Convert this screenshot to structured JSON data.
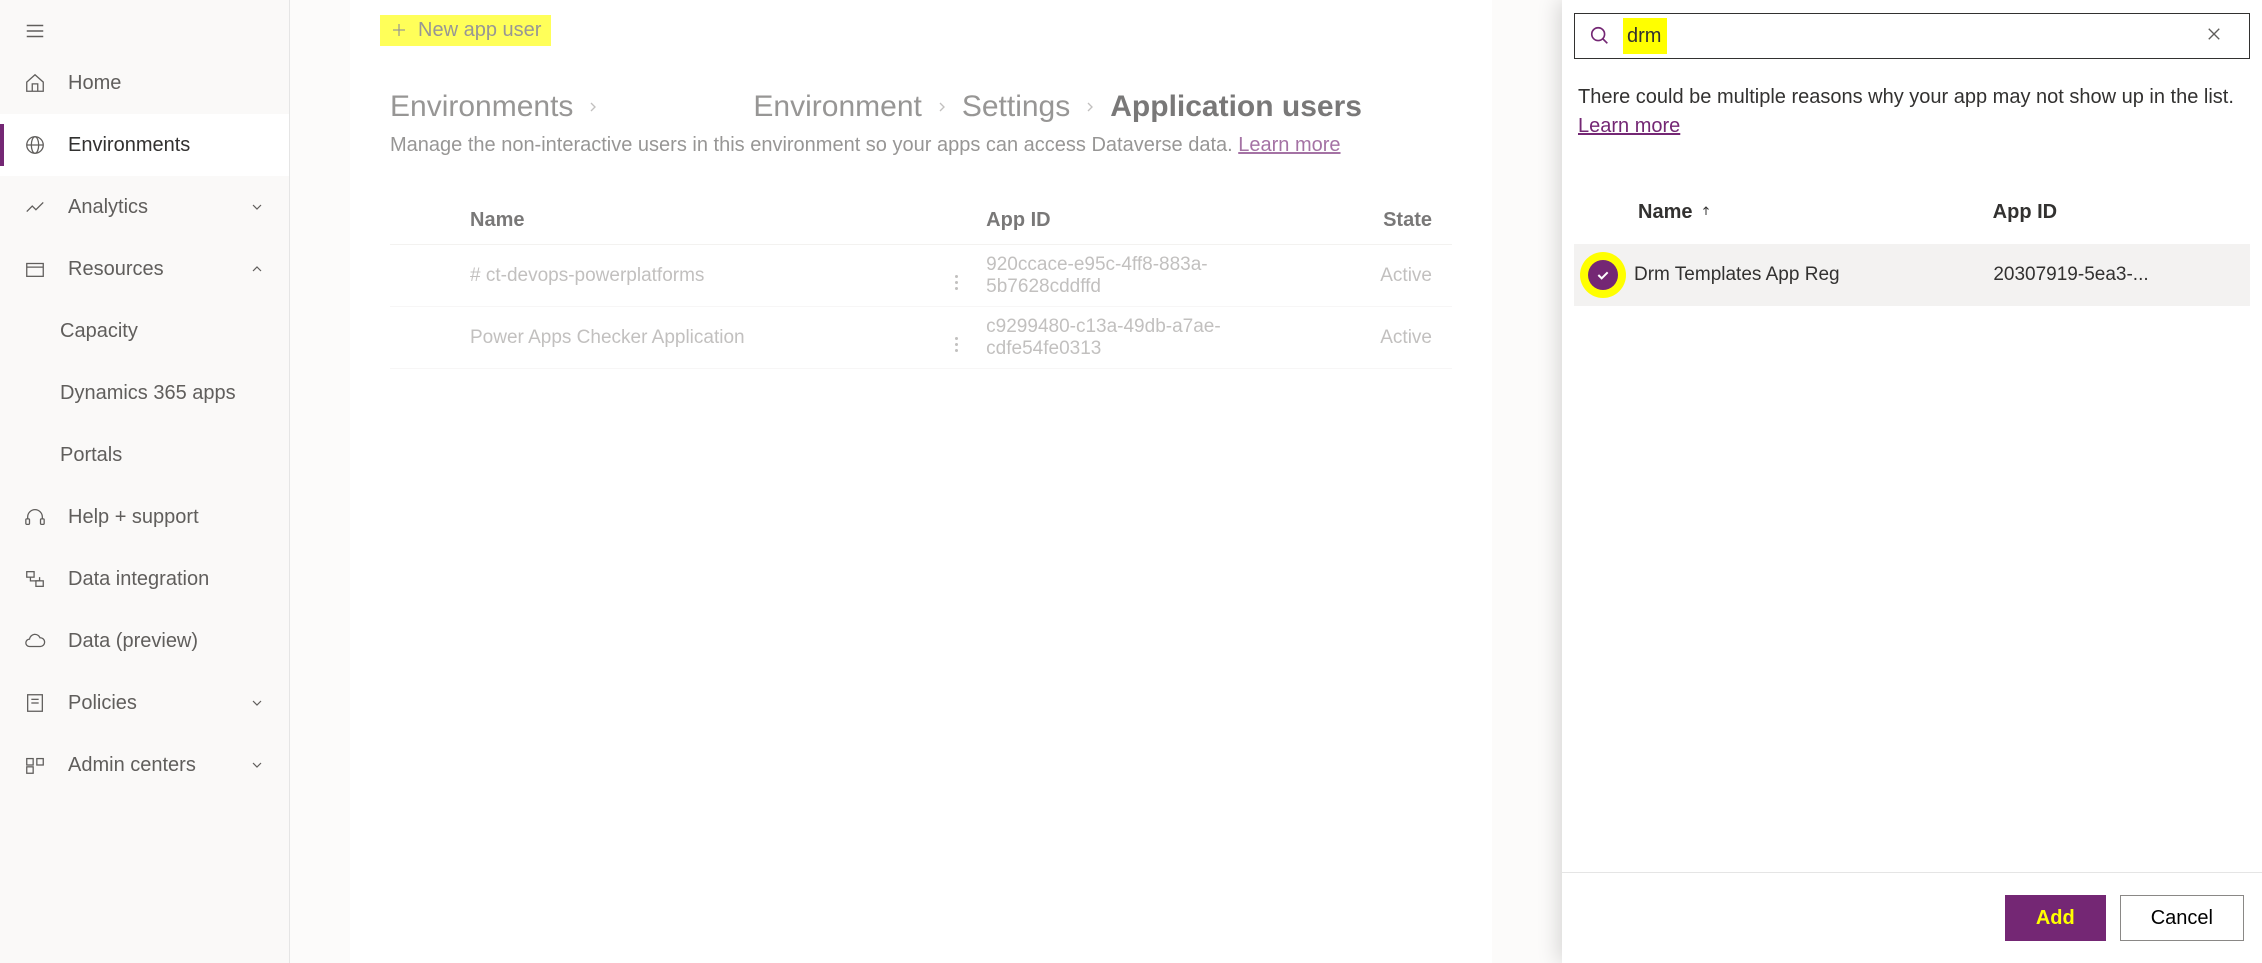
{
  "sidebar": {
    "home": "Home",
    "environments": "Environments",
    "analytics": "Analytics",
    "resources": "Resources",
    "resources_sub": {
      "capacity": "Capacity",
      "d365": "Dynamics 365 apps",
      "portals": "Portals"
    },
    "help": "Help + support",
    "data_integration": "Data integration",
    "data_preview": "Data (preview)",
    "policies": "Policies",
    "admin_centers": "Admin centers"
  },
  "topbar": {
    "new_app_user": "New app user"
  },
  "breadcrumb": {
    "environments": "Environments",
    "environment": "Environment",
    "settings": "Settings",
    "current": "Application users"
  },
  "subtitle": {
    "text": "Manage the non-interactive users in this environment so your apps can access Dataverse data. ",
    "link": "Learn more"
  },
  "table": {
    "columns": {
      "name": "Name",
      "appid": "App ID",
      "state": "State"
    },
    "rows": [
      {
        "name": "# ct-devops-powerplatforms",
        "appid": "920ccace-e95c-4ff8-883a-5b7628cddffd",
        "state": "Active"
      },
      {
        "name": "Power Apps Checker Application",
        "appid": "c9299480-c13a-49db-a7ae-cdfe54fe0313",
        "state": "Active"
      }
    ]
  },
  "panel": {
    "search_value": "drm",
    "info_text": "There could be multiple reasons why your app may not show up in the list.",
    "info_link": "Learn more",
    "columns": {
      "name": "Name",
      "appid": "App ID"
    },
    "rows": [
      {
        "name": "Drm Templates App Reg",
        "appid": "20307919-5ea3-..."
      }
    ],
    "add": "Add",
    "cancel": "Cancel"
  }
}
